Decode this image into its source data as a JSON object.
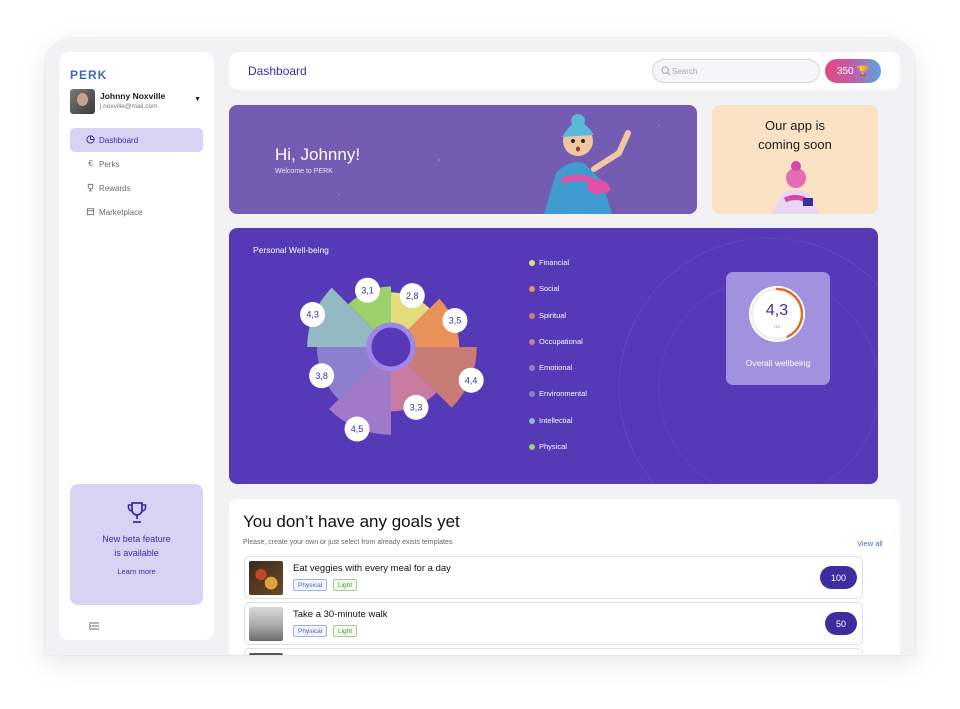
{
  "app": {
    "logo": "PERK"
  },
  "user": {
    "name": "Johnny Noxville",
    "email": "j.noxville@mail.com"
  },
  "sidebar": {
    "items": [
      {
        "label": "Dashboard",
        "icon": "pie-chart-icon",
        "active": true
      },
      {
        "label": "Perks",
        "icon": "euro-icon",
        "active": false
      },
      {
        "label": "Rewards",
        "icon": "trophy-icon",
        "active": false
      },
      {
        "label": "Marketplace",
        "icon": "store-icon",
        "active": false
      }
    ],
    "beta": {
      "title_line1": "New beta feature",
      "title_line2": "is available",
      "link": "Learn more"
    }
  },
  "header": {
    "title": "Dashboard",
    "search_placeholder": "Search",
    "points": "350"
  },
  "hero": {
    "title": "Hi, Johnny!",
    "subtitle": "Welcome to PERK"
  },
  "promo": {
    "line1": "Our app is",
    "line2": "coming soon"
  },
  "wellbeing": {
    "title": "Personal Well-being",
    "overall_value": "4,3",
    "overall_of": "/10",
    "overall_label": "Overall wellbeing",
    "overall_fraction": 0.43
  },
  "chart_data": {
    "type": "pie",
    "title": "Personal Well-being",
    "variant": "polar-area",
    "categories": [
      "Financial",
      "Social",
      "Spiritual",
      "Occupational",
      "Emotional",
      "Environmental",
      "Intellectial",
      "Physical"
    ],
    "values": [
      2.8,
      3.5,
      4.4,
      3.3,
      4.5,
      3.8,
      4.3,
      3.1
    ],
    "value_labels": [
      "2,8",
      "3,5",
      "4,4",
      "3,3",
      "4,5",
      "3,8",
      "4,3",
      "3,1"
    ],
    "colors": [
      "#e4dd7e",
      "#e89158",
      "#c97b76",
      "#c97aa0",
      "#a07ac9",
      "#8c7fcf",
      "#93b9c3",
      "#9bd06a"
    ],
    "legend_position": "right"
  },
  "goals": {
    "title": "You don’t have any goals yet",
    "subtitle": "Please, create your own or just select from already exists templates",
    "view_all": "View all",
    "items": [
      {
        "title": "Eat veggies with every meal for a day",
        "tag1": "Physical",
        "tag2": "Light",
        "points": "100"
      },
      {
        "title": "Take a 30-minute walk",
        "tag1": "Physical",
        "tag2": "Light",
        "points": "50"
      }
    ]
  }
}
